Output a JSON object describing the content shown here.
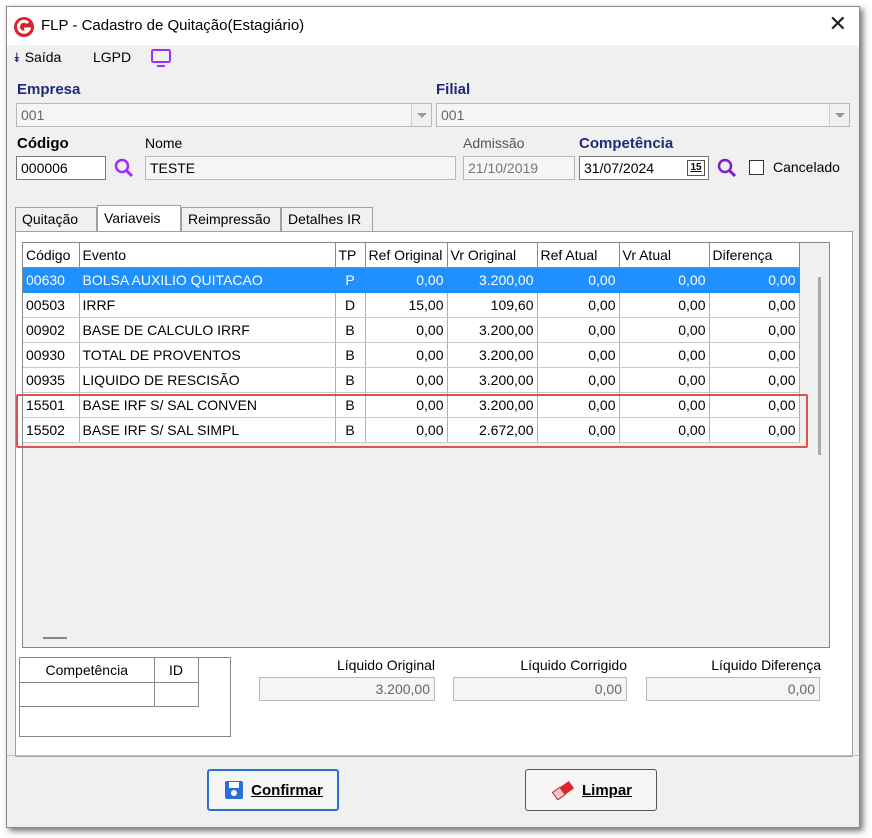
{
  "window": {
    "title": "FLP - Cadastro de Quitação(Estagiário)"
  },
  "menu": {
    "saida": "Saída",
    "lgpd": "LGPD"
  },
  "form": {
    "empresa_label": "Empresa",
    "empresa_value": "001",
    "filial_label": "Filial",
    "filial_value": "001",
    "codigo_label": "Código",
    "codigo_value": "000006",
    "nome_label": "Nome",
    "nome_value": "TESTE",
    "admissao_label": "Admissão",
    "admissao_value": "21/10/2019",
    "competencia_label": "Competência",
    "competencia_value": "31/07/2024",
    "calendar_day": "15",
    "cancelado_label": "Cancelado",
    "cancelado_checked": false
  },
  "tabs": [
    {
      "label": "Quitação",
      "active": false
    },
    {
      "label": "Variaveis",
      "active": true
    },
    {
      "label": "Reimpressão",
      "active": false
    },
    {
      "label": "Detalhes IR",
      "active": false
    }
  ],
  "grid": {
    "columns": [
      "Código",
      "Evento",
      "TP",
      "Ref Original",
      "Vr Original",
      "Ref Atual",
      "Vr Atual",
      "Diferença"
    ],
    "rows": [
      {
        "codigo": "00630",
        "evento": "BOLSA AUXILIO QUITACAO",
        "tp": "P",
        "ref_original": "0,00",
        "vr_original": "3.200,00",
        "ref_atual": "0,00",
        "vr_atual": "0,00",
        "diferenca": "0,00",
        "selected": true
      },
      {
        "codigo": "00503",
        "evento": "IRRF",
        "tp": "D",
        "ref_original": "15,00",
        "vr_original": "109,60",
        "ref_atual": "0,00",
        "vr_atual": "0,00",
        "diferenca": "0,00"
      },
      {
        "codigo": "00902",
        "evento": "BASE DE CALCULO IRRF",
        "tp": "B",
        "ref_original": "0,00",
        "vr_original": "3.200,00",
        "ref_atual": "0,00",
        "vr_atual": "0,00",
        "diferenca": "0,00"
      },
      {
        "codigo": "00930",
        "evento": "TOTAL DE PROVENTOS",
        "tp": "B",
        "ref_original": "0,00",
        "vr_original": "3.200,00",
        "ref_atual": "0,00",
        "vr_atual": "0,00",
        "diferenca": "0,00"
      },
      {
        "codigo": "00935",
        "evento": "LIQUIDO DE RESCISÃO",
        "tp": "B",
        "ref_original": "0,00",
        "vr_original": "3.200,00",
        "ref_atual": "0,00",
        "vr_atual": "0,00",
        "diferenca": "0,00"
      },
      {
        "codigo": "15501",
        "evento": "BASE IRF S/ SAL CONVEN",
        "tp": "B",
        "ref_original": "0,00",
        "vr_original": "3.200,00",
        "ref_atual": "0,00",
        "vr_atual": "0,00",
        "diferenca": "0,00",
        "highlighted": true
      },
      {
        "codigo": "15502",
        "evento": "BASE IRF S/ SAL SIMPL",
        "tp": "B",
        "ref_original": "0,00",
        "vr_original": "2.672,00",
        "ref_atual": "0,00",
        "vr_atual": "0,00",
        "diferenca": "0,00",
        "highlighted": true
      }
    ]
  },
  "mini_grid": {
    "columns": [
      "Competência",
      "ID"
    ]
  },
  "summary": {
    "liquido_original_label": "Líquido Original",
    "liquido_original_value": "3.200,00",
    "liquido_corrigido_label": "Líquido Corrigido",
    "liquido_corrigido_value": "0,00",
    "liquido_diferenca_label": "Líquido Diferença",
    "liquido_diferenca_value": "0,00"
  },
  "buttons": {
    "confirmar": "Confirmar",
    "limpar": "Limpar"
  },
  "colors": {
    "selection": "#1e90ff",
    "accent_label": "#1f2a7a",
    "highlight_border": "#d9534f",
    "search_icon": "#9b30ff"
  }
}
